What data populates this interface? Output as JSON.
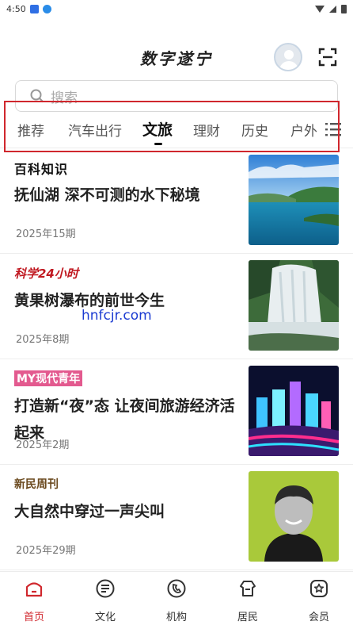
{
  "status_bar": {
    "time": "4:50"
  },
  "header": {
    "app_title": "数字遂宁"
  },
  "search": {
    "placeholder": "搜索"
  },
  "tabs": [
    "推荐",
    "汽车出行",
    "文旅",
    "理财",
    "历史",
    "户外"
  ],
  "active_tab": "文旅",
  "articles": [
    {
      "source": "百科知识",
      "title": "抚仙湖 深不可测的水下秘境",
      "issue": "2025年15期",
      "image": "lake-landscape"
    },
    {
      "source": "科学24小时",
      "title": "黄果树瀑布的前世今生",
      "issue": "2025年8期",
      "image": "waterfall"
    },
    {
      "source": "MY现代青年",
      "title": "打造新“夜”态 让夜间旅游经济活起来",
      "issue": "2025年2期",
      "image": "night-lights"
    },
    {
      "source": "新民周刊",
      "title": "大自然中穿过一声尖叫",
      "issue": "2025年29期",
      "image": "portrait"
    }
  ],
  "watermark": "hnfcjr.com",
  "bottom_nav": [
    {
      "label": "首页",
      "icon": "home-icon",
      "active": true
    },
    {
      "label": "文化",
      "icon": "culture-icon",
      "active": false
    },
    {
      "label": "机构",
      "icon": "institution-icon",
      "active": false
    },
    {
      "label": "居民",
      "icon": "resident-icon",
      "active": false
    },
    {
      "label": "会员",
      "icon": "member-icon",
      "active": false
    }
  ],
  "colors": {
    "accent": "#d0272d",
    "highlight_box": "#d0272d"
  }
}
